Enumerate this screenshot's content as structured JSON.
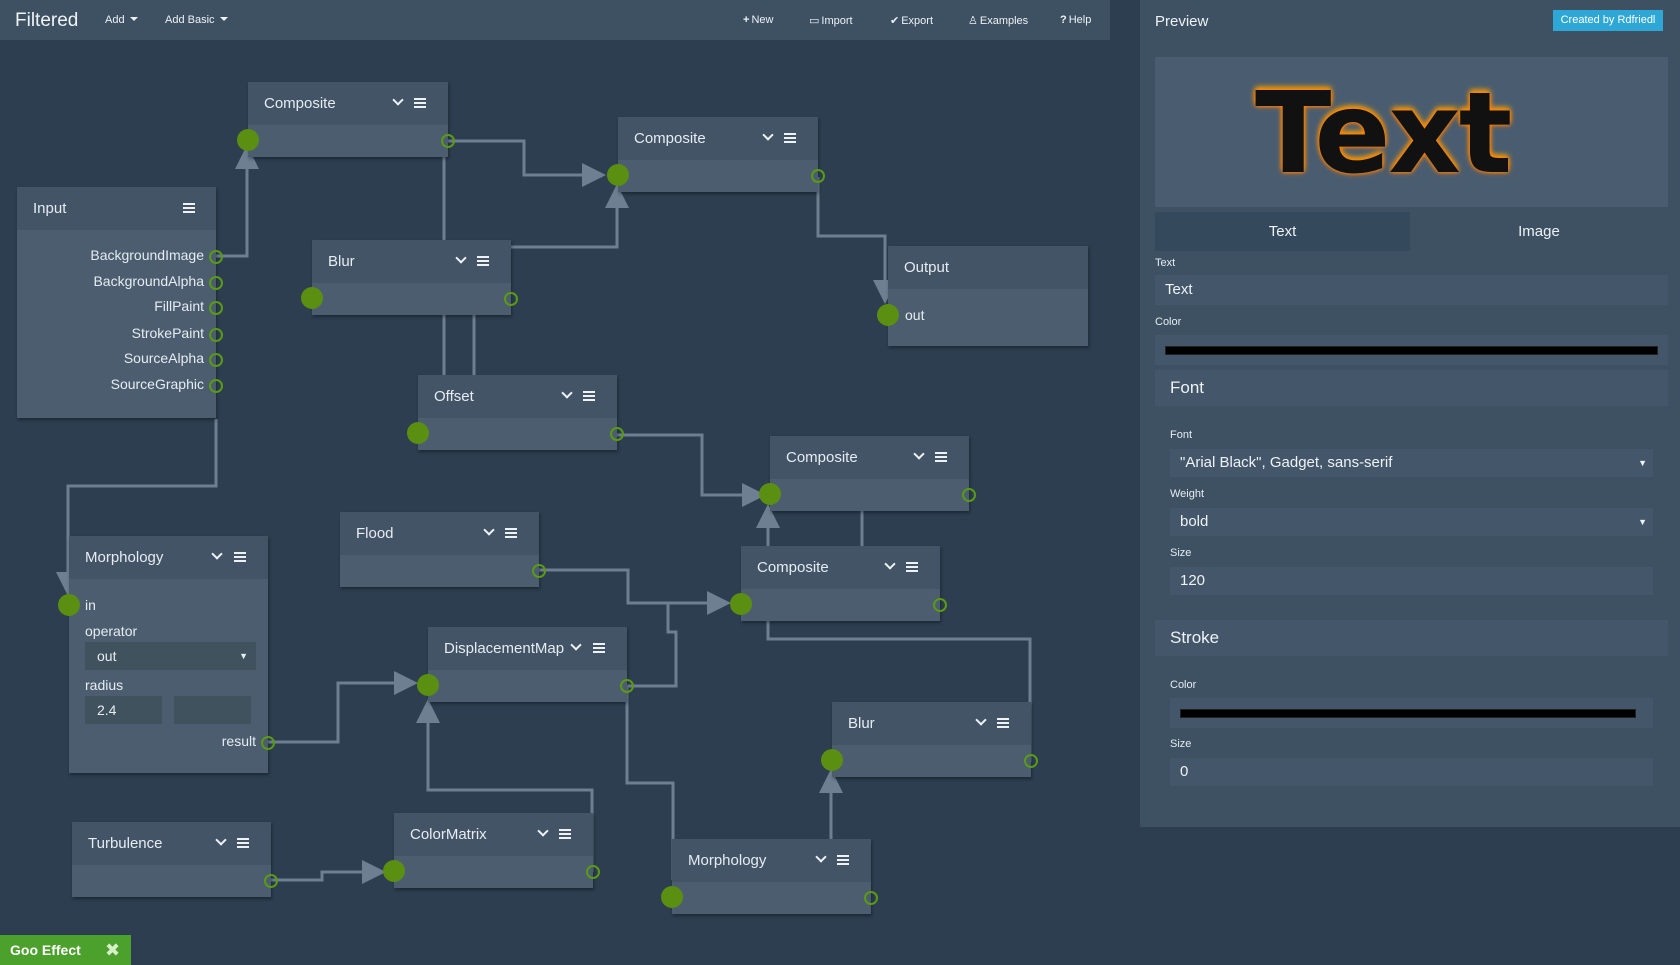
{
  "topbar": {
    "brand": "Filtered",
    "menus": [
      "Add",
      "Add Basic"
    ],
    "actions": [
      {
        "icon": "plus-icon",
        "glyph": "+",
        "label": "New"
      },
      {
        "icon": "folder-open-icon",
        "glyph": "▭",
        "label": "Import"
      },
      {
        "icon": "checkmark-icon",
        "glyph": "✔",
        "label": "Export"
      },
      {
        "icon": "flask-icon",
        "glyph": "♙",
        "label": "Examples"
      },
      {
        "icon": "question-icon",
        "glyph": "?",
        "label": "Help"
      }
    ]
  },
  "nodes": {
    "input": {
      "title": "Input",
      "outputs": [
        "BackgroundImage",
        "BackgroundAlpha",
        "FillPaint",
        "StrokePaint",
        "SourceAlpha",
        "SourceGraphic"
      ]
    },
    "composite1": {
      "title": "Composite"
    },
    "composite2": {
      "title": "Composite"
    },
    "composite3": {
      "title": "Composite"
    },
    "composite4": {
      "title": "Composite"
    },
    "blur1": {
      "title": "Blur"
    },
    "blur2": {
      "title": "Blur"
    },
    "offset": {
      "title": "Offset"
    },
    "flood": {
      "title": "Flood"
    },
    "displacement": {
      "title": "DisplacementMap"
    },
    "colormatrix": {
      "title": "ColorMatrix"
    },
    "turbulence": {
      "title": "Turbulence"
    },
    "morphology1": {
      "title": "Morphology",
      "in_label": "in",
      "operator_label": "operator",
      "operator_value": "out",
      "radius_label": "radius",
      "radius_value": "2.4",
      "radius_value2": "",
      "result_label": "result"
    },
    "morphology2": {
      "title": "Morphology"
    },
    "output": {
      "title": "Output",
      "out_label": "out"
    }
  },
  "preview": {
    "title": "Preview",
    "credit": "Created by Rdfriedl",
    "sample_text": "Text",
    "tabs": [
      "Text",
      "Image"
    ],
    "text_label": "Text",
    "text_value": "Text",
    "color_label": "Color",
    "text_color": "#000000",
    "font_section": "Font",
    "font_label": "Font",
    "font_value": "\"Arial Black\", Gadget, sans-serif",
    "weight_label": "Weight",
    "weight_value": "bold",
    "size_label": "Size",
    "size_value": "120",
    "stroke_section": "Stroke",
    "stroke_color_label": "Color",
    "stroke_color": "#000000",
    "stroke_size_label": "Size",
    "stroke_size_value": "0"
  },
  "footer": {
    "label": "Goo Effect",
    "close_glyph": "✖"
  },
  "colors": {
    "accent_green": "#5a8f12",
    "canvas_bg": "#2c3e50",
    "node_bg": "#4b5d6f",
    "badge_blue": "#2fa7d6",
    "goo_green": "#4ca02c"
  }
}
